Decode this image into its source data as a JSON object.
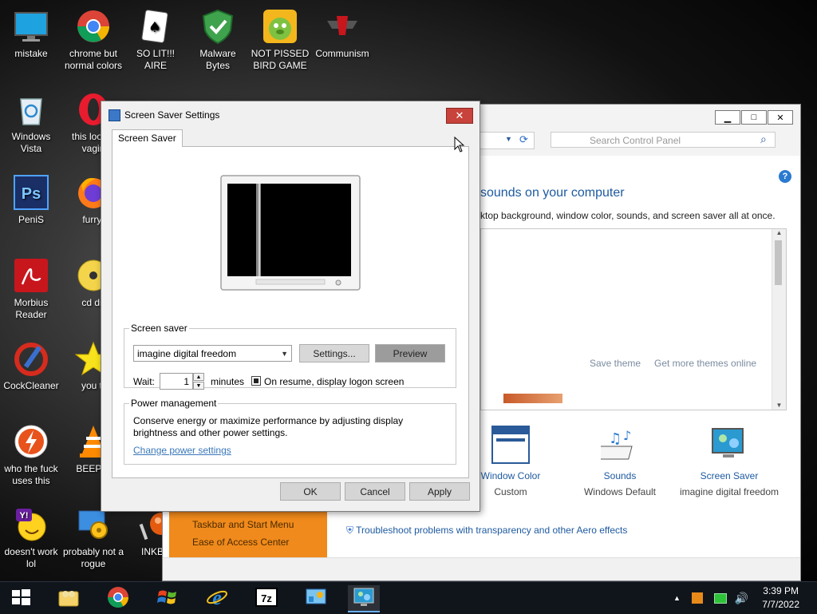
{
  "desktop": {
    "icons": [
      {
        "label": "mistake",
        "icon": "monitor-icon"
      },
      {
        "label": "chrome but normal colors",
        "icon": "chrome-icon"
      },
      {
        "label": "SO LIT!!! AIRE",
        "icon": "solitaire-icon"
      },
      {
        "label": "Malware Bytes",
        "icon": "shield-icon"
      },
      {
        "label": "NOT PISSED BIRD GAME",
        "icon": "bird-game-icon"
      },
      {
        "label": "Communism",
        "icon": "communism-icon"
      },
      {
        "label": "Windows Vista",
        "icon": "recycle-bin-icon"
      },
      {
        "label": "this look a vagin",
        "icon": "opera-icon"
      },
      {
        "label": "PeniS",
        "icon": "photoshop-icon"
      },
      {
        "label": "furryf",
        "icon": "firefox-icon"
      },
      {
        "label": "Morbius Reader",
        "icon": "pdf-reader-icon"
      },
      {
        "label": "cd dri",
        "icon": "cd-drive-icon"
      },
      {
        "label": "CockCleaner",
        "icon": "ccleaner-icon"
      },
      {
        "label": "you tr",
        "icon": "star-icon"
      },
      {
        "label": "who the fuck uses this",
        "icon": "lightning-icon"
      },
      {
        "label": "BEEP B",
        "icon": "vlc-icon"
      },
      {
        "label": "doesn't work lol",
        "icon": "yahoo-messenger-icon"
      },
      {
        "label": "probably not a rogue",
        "icon": "rogue-app-icon"
      },
      {
        "label": "INKBA",
        "icon": "inkball-icon"
      }
    ]
  },
  "control_panel": {
    "search_placeholder": "Search Control Panel",
    "heading": "sounds on your computer",
    "subheading": "ktop background, window color, sounds, and screen saver all at once.",
    "save_theme": "Save theme",
    "get_more_themes": "Get more themes online",
    "bottom_items": [
      {
        "title": "Window Color",
        "subtitle": "Custom"
      },
      {
        "title": "Sounds",
        "subtitle": "Windows Default"
      },
      {
        "title": "Screen Saver",
        "subtitle": "imagine digital freedom"
      }
    ],
    "see_also": [
      "Taskbar and Start Menu",
      "Ease of Access Center"
    ],
    "troubleshoot_link": "Troubleshoot problems with transparency and other Aero effects"
  },
  "dialog": {
    "title": "Screen Saver Settings",
    "close_label": "✕",
    "tab": "Screen Saver",
    "screen_saver_group": "Screen saver",
    "selected_saver": "imagine digital freedom",
    "settings_button": "Settings...",
    "preview_button": "Preview",
    "wait_label": "Wait:",
    "wait_value": "1",
    "minutes_label": "minutes",
    "resume_label": "On resume, display logon screen",
    "power_group": "Power management",
    "power_text": "Conserve energy or maximize performance by adjusting display brightness and other power settings.",
    "power_link": "Change power settings",
    "ok": "OK",
    "cancel": "Cancel",
    "apply": "Apply"
  },
  "taskbar": {
    "apps": [
      "start-icon",
      "file-explorer-icon",
      "chrome-icon",
      "windows-xp-icon",
      "internet-explorer-icon",
      "7zip-icon",
      "control-panel-icon",
      "screen-saver-icon"
    ],
    "time": "3:39 PM",
    "date": "7/7/2022"
  },
  "colors": {
    "link_blue": "#1e5aa0",
    "close_red": "#c8433b",
    "see_also_orange": "#f08a1c"
  }
}
